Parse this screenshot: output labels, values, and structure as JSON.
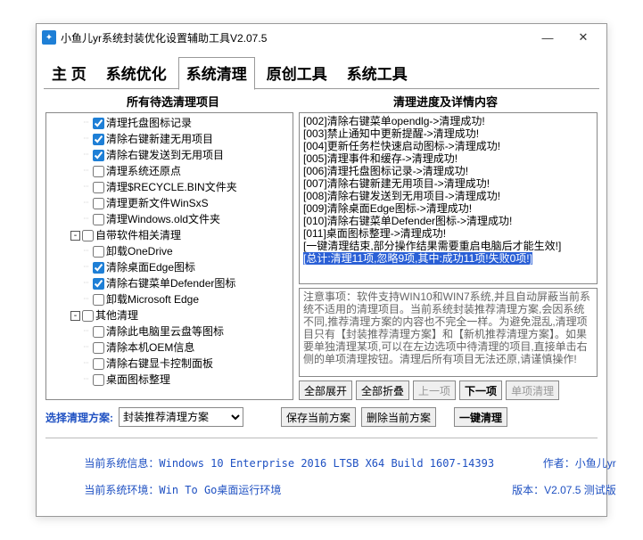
{
  "window": {
    "title": "小鱼儿yr系统封装优化设置辅助工具V2.07.5",
    "controls": {
      "minimize": "—",
      "close": "✕"
    }
  },
  "tabs": [
    {
      "id": "home",
      "label": "主  页"
    },
    {
      "id": "optimize",
      "label": "系统优化"
    },
    {
      "id": "clean",
      "label": "系统清理",
      "active": true
    },
    {
      "id": "original",
      "label": "原创工具"
    },
    {
      "id": "systools",
      "label": "系统工具"
    }
  ],
  "headers": {
    "left": "所有待选清理项目",
    "right": "清理进度及详情内容"
  },
  "tree": [
    {
      "lvl": 3,
      "checked": true,
      "label": "清理托盘图标记录"
    },
    {
      "lvl": 3,
      "checked": true,
      "label": "清除右键新建无用项目"
    },
    {
      "lvl": 3,
      "checked": true,
      "label": "清除右键发送到无用项目"
    },
    {
      "lvl": 3,
      "checked": false,
      "label": "清理系统还原点"
    },
    {
      "lvl": 3,
      "checked": false,
      "label": "清理$RECYCLE.BIN文件夹"
    },
    {
      "lvl": 3,
      "checked": false,
      "label": "清理更新文件WinSxS"
    },
    {
      "lvl": 3,
      "checked": false,
      "label": "清理Windows.old文件夹"
    },
    {
      "lvl": 2,
      "expand": "-",
      "checked": false,
      "label": "自带软件相关清理",
      "group": true
    },
    {
      "lvl": 3,
      "checked": false,
      "label": "卸载OneDrive"
    },
    {
      "lvl": 3,
      "checked": true,
      "label": "清除桌面Edge图标"
    },
    {
      "lvl": 3,
      "checked": true,
      "label": "清除右键菜单Defender图标"
    },
    {
      "lvl": 3,
      "checked": false,
      "label": "卸载Microsoft Edge"
    },
    {
      "lvl": 2,
      "expand": "-",
      "checked": false,
      "label": "其他清理",
      "group": true
    },
    {
      "lvl": 3,
      "checked": false,
      "label": "清除此电脑里云盘等图标"
    },
    {
      "lvl": 3,
      "checked": false,
      "label": "清除本机OEM信息"
    },
    {
      "lvl": 3,
      "checked": false,
      "label": "清除右键显卡控制面板"
    },
    {
      "lvl": 3,
      "checked": false,
      "label": "桌面图标整理"
    }
  ],
  "log_lines": [
    "[002]清除右键菜单opendlg->清理成功!",
    "[003]禁止通知中更新提醒->清理成功!",
    "[004]更新任务栏快速启动图标->清理成功!",
    "[005]清理事件和缓存->清理成功!",
    "[006]清理托盘图标记录->清理成功!",
    "[007]清除右键新建无用项目->清理成功!",
    "[008]清除右键发送到无用项目->清理成功!",
    "[009]清除桌面Edge图标->清理成功!",
    "[010]清除右键菜单Defender图标->清理成功!",
    "[011]桌面图标整理->清理成功!",
    "[一键清理结束,部分操作结果需要重启电脑后才能生效!]"
  ],
  "log_selected": "[总计:清理11项,忽略9项,其中:成功11项!失败0项!]",
  "note_text": "注意事项：软件支持WIN10和WIN7系统,并且自动屏蔽当前系统不适用的清理项目。当前系统封装推荐清理方案,会因系统不同,推荐清理方案的内容也不完全一样。为避免混乱,清理项目只有【封装推荐清理方案】和【新机推荐清理方案】。如果要单独清理某项,可以在左边选项中待清理的项目,直接单击右侧的单项清理按钮。清理后所有项目无法还原,请谨慎操作!",
  "buttons_row": {
    "expand_all": "全部展开",
    "collapse_all": "全部折叠",
    "prev": "上一项",
    "next": "下一项",
    "single": "单项清理"
  },
  "bottom": {
    "scheme_label": "选择清理方案:",
    "scheme_selected": "封装推荐清理方案",
    "save_scheme": "保存当前方案",
    "delete_scheme": "删除当前方案",
    "one_click": "一键清理"
  },
  "status": {
    "sys_info_label": "当前系统信息：",
    "sys_info_value": "Windows 10 Enterprise 2016 LTSB X64 Build 1607-14393",
    "env_label": "当前系统环境：",
    "env_value": "Win To Go桌面运行环境",
    "author_label": "作者：",
    "author_value": "小鱼儿yr",
    "version_label": "版本：",
    "version_value": "V2.07.5 测试版"
  }
}
